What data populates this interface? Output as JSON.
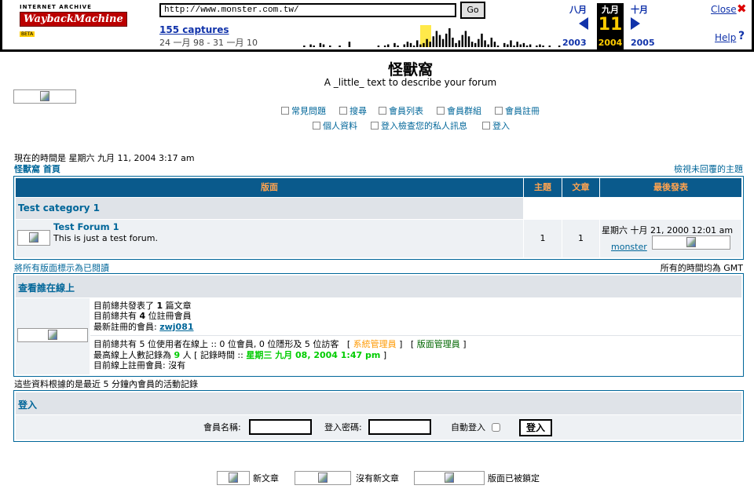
{
  "wayback": {
    "logo_top": "INTERNET ARCHIVE",
    "logo_main": "WaybackMachine",
    "logo_beta": "BETA",
    "url": "http://www.monster.com.tw/",
    "go_label": "Go",
    "captures": "155 captures",
    "date_range": "24 一月 98 - 31 一月 10",
    "month_prev": "八月",
    "month_cur": "九月",
    "month_next": "十月",
    "day": "11",
    "year_prev": "2003",
    "year_cur": "2004",
    "year_next": "2005",
    "close_label": "Close",
    "close_icon": "✖",
    "help_label": "Help",
    "help_icon": "?",
    "spark": [
      0,
      0,
      0,
      0,
      0,
      0,
      0,
      0,
      0,
      0,
      1,
      0,
      2,
      1,
      0,
      3,
      2,
      0,
      1,
      0,
      0,
      1,
      0,
      0,
      4,
      0,
      0,
      0,
      0,
      0,
      0,
      0,
      0,
      1,
      0,
      1,
      2,
      0,
      3,
      1,
      0,
      2,
      4,
      3,
      1,
      5,
      2,
      3,
      6,
      4,
      8,
      12,
      9,
      6,
      10,
      14,
      7,
      3,
      5,
      9,
      12,
      8,
      4,
      3,
      6,
      10,
      5,
      2,
      7,
      4,
      1,
      0,
      3,
      2,
      5,
      1,
      4,
      2,
      3,
      1,
      2,
      0,
      1,
      2,
      1,
      0,
      1,
      0,
      0,
      1
    ]
  },
  "header": {
    "title": "怪獸窩",
    "description": "A _little_ text to describe your forum"
  },
  "nav": {
    "faq": "常見問題",
    "search": "搜尋",
    "memberlist": "會員列表",
    "usergroups": "會員群組",
    "register": "會員註冊",
    "profile": "個人資料",
    "pm": "登入檢查您的私人訊息",
    "login": "登入"
  },
  "status": {
    "current_time": "現在的時間是 星期六 九月 11, 2004 3:17 am",
    "home_link": "怪獸窩 首頁",
    "unanswered": "檢視未回覆的主題"
  },
  "forum_table": {
    "col_forum": "版面",
    "col_topics": "主題",
    "col_posts": "文章",
    "col_last": "最後發表",
    "category": "Test category 1",
    "forum_name": "Test Forum 1",
    "forum_desc": "This is just a test forum.",
    "topics": "1",
    "posts": "1",
    "last_post_time": "星期六 十月 21, 2000 12:01 am",
    "last_post_user": "monster"
  },
  "below_table": {
    "mark_read": "將所有版面標示為已閱讀",
    "timezone": "所有的時間均為 GMT"
  },
  "online": {
    "title": "查看誰在線上",
    "posts_pre": "目前總共發表了",
    "posts_count": "1",
    "posts_post": "篇文章",
    "users_pre": "目前總共有",
    "users_count": "4",
    "users_post": "位註冊會員",
    "newest_label": "最新註冊的會員:",
    "newest_user": "zwj081",
    "online_line": "目前總共有 5 位使用者在線上 :: 0 位會員, 0 位隱形及 5 位訪客",
    "admin_label": "系統管理員",
    "mod_label": "版面管理員",
    "record_pre": "最高線上人數記錄為",
    "record_count": "9",
    "record_mid": "人 [ 記錄時間 ::",
    "record_time": "星期三 九月 08, 2004 1:47 pm",
    "record_post": "]",
    "registered_online": "目前線上註冊會員: 沒有",
    "footer_note": "這些資料根據的是最近 5 分鐘內會員的活動記錄"
  },
  "login": {
    "title": "登入",
    "username_label": "會員名稱:",
    "password_label": "登入密碼:",
    "autologin_label": "自動登入",
    "submit_label": "登入"
  },
  "legend": {
    "new_posts": "新文章",
    "no_new_posts": "沒有新文章",
    "locked": "版面已被鎖定"
  }
}
